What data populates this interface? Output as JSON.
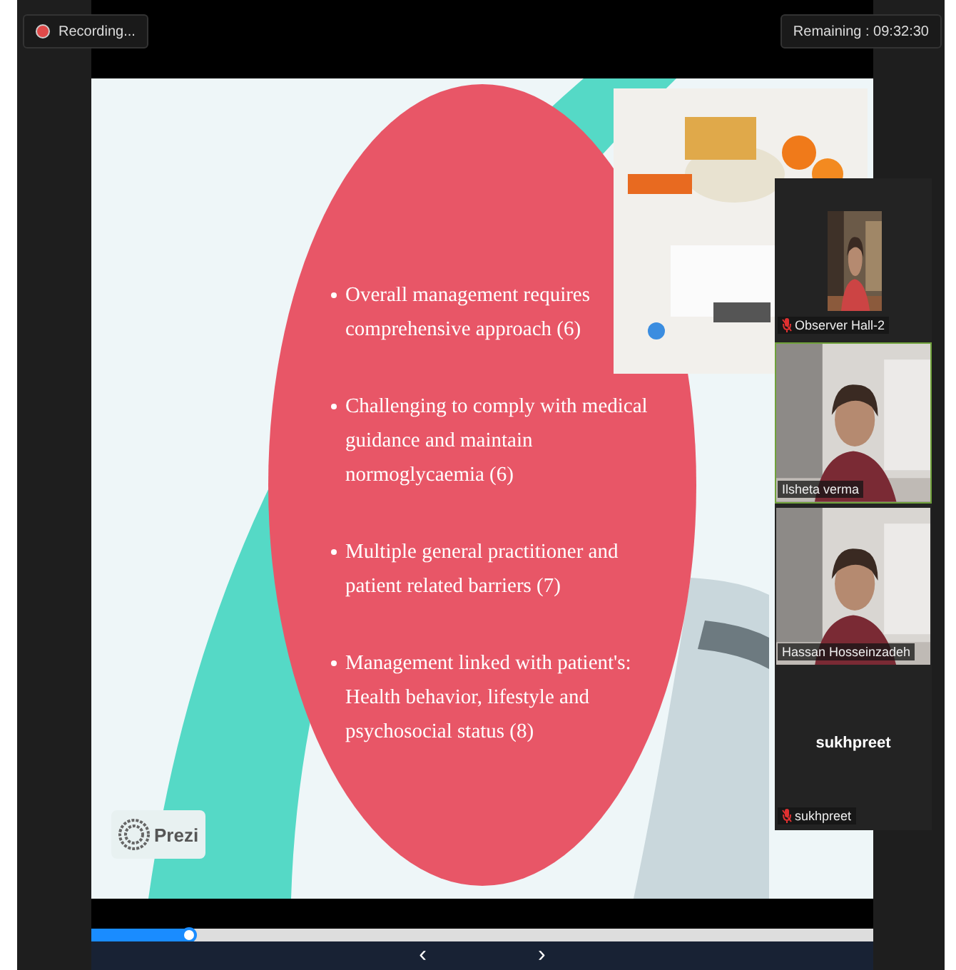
{
  "recording": {
    "label": "Recording..."
  },
  "remaining": {
    "label": "Remaining : 09:32:30"
  },
  "slide": {
    "bullets": [
      "Overall management requires comprehensive approach (6)",
      "Challenging to comply with medical guidance and maintain normoglycaemia (6)",
      "Multiple general practitioner and patient related barriers (7)",
      "Management linked with patient's: Health behavior, lifestyle and psychosocial status (8)"
    ],
    "logo": {
      "label": "Prezi"
    }
  },
  "participants": [
    {
      "name": "Observer Hall-2",
      "muted": true,
      "kind": "thumbnail",
      "speaking": false
    },
    {
      "name": "Ilsheta verma",
      "muted": false,
      "kind": "video",
      "speaking": true
    },
    {
      "name": "Hassan Hosseinzadeh",
      "muted": false,
      "kind": "video",
      "speaking": false
    },
    {
      "name": "sukhpreet",
      "display_name": "sukhpreet",
      "muted": true,
      "kind": "avatar",
      "speaking": false
    }
  ],
  "player": {
    "level": 0.124,
    "prev": "‹",
    "next": "›"
  }
}
